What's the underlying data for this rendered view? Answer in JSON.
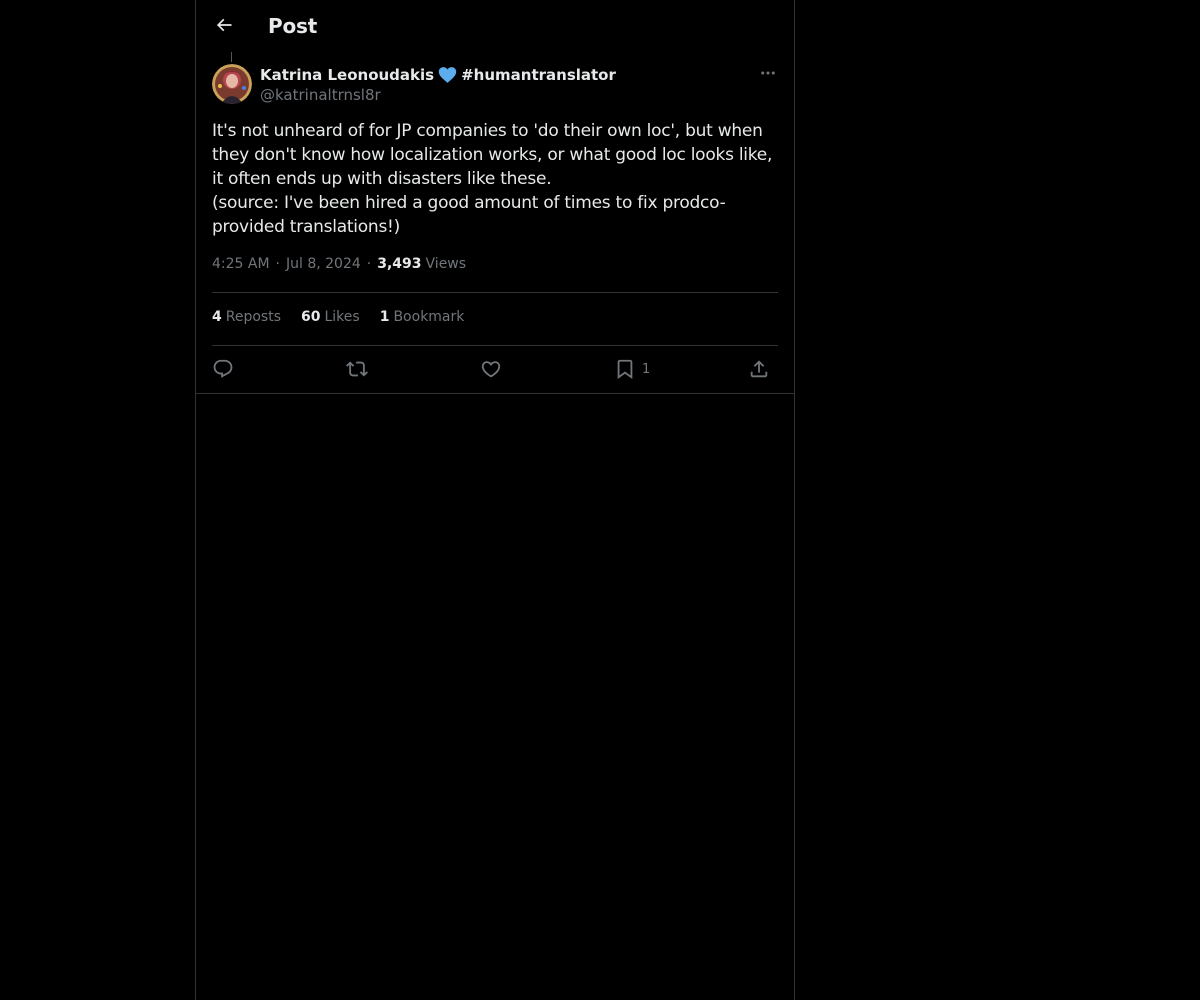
{
  "header": {
    "title": "Post",
    "back_icon": "arrow-left-icon"
  },
  "post": {
    "author": {
      "display_name": "Katrina Leonoudakis",
      "emoji": "blue-heart-icon",
      "hashtag": "#humantranslator",
      "handle": "@katrinaltrnsl8r"
    },
    "text": "It's not unheard of for JP companies to 'do their own loc', but when they don't know how localization works, or what good loc looks like, it often ends up with disasters like these.\n(source: I've been hired a good amount of times to fix prodco-provided translations!)",
    "time": "4:25 AM",
    "separator": "·",
    "date": "Jul 8, 2024",
    "views_count": "3,493",
    "views_label": "Views"
  },
  "stats": {
    "reposts_count": "4",
    "reposts_label": "Reposts",
    "likes_count": "60",
    "likes_label": "Likes",
    "bookmarks_count": "1",
    "bookmarks_label": "Bookmark"
  },
  "actions": {
    "reply_icon": "reply-icon",
    "repost_icon": "repost-icon",
    "like_icon": "like-heart-icon",
    "bookmark_icon": "bookmark-icon",
    "bookmark_count": "1",
    "share_icon": "share-icon"
  },
  "colors": {
    "background": "#000000",
    "text_primary": "#e7e9ea",
    "text_secondary": "#71767b",
    "border": "#2f3336",
    "emoji_blue": "#5dadec"
  }
}
